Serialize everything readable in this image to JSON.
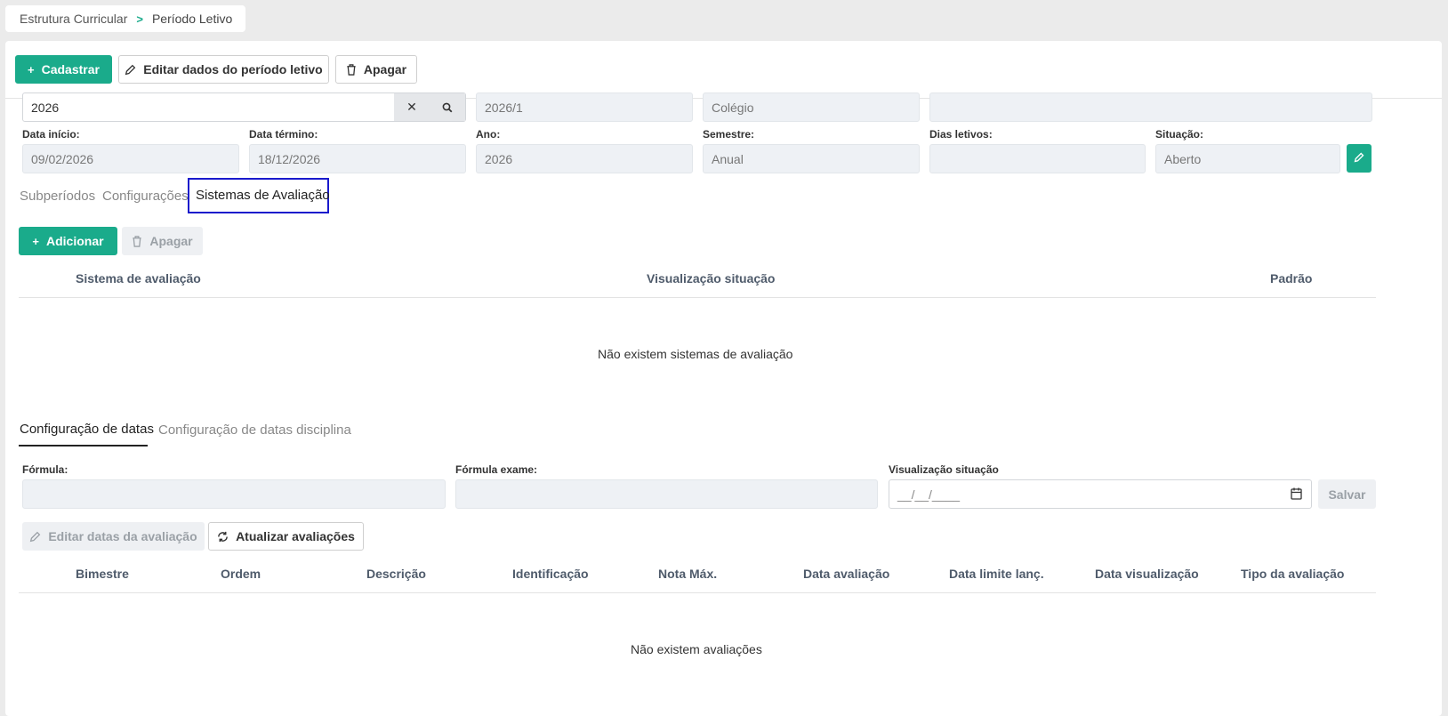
{
  "breadcrumb": {
    "parent": "Estrutura Curricular",
    "separator": ">",
    "current": "Período Letivo"
  },
  "toolbar": {
    "cadastrar": "Cadastrar",
    "editar": "Editar dados do período letivo",
    "apagar": "Apagar"
  },
  "form": {
    "search_value": "2026",
    "periodo": "2026/1",
    "instituicao": "Colégio",
    "descricao": "",
    "data_inicio_label": "Data início:",
    "data_inicio": "09/02/2026",
    "data_termino_label": "Data término:",
    "data_termino": "18/12/2026",
    "ano_label": "Ano:",
    "ano": "2026",
    "semestre_label": "Semestre:",
    "semestre": "Anual",
    "dias_letivos_label": "Dias letivos:",
    "dias_letivos": "",
    "situacao_label": "Situação:",
    "situacao": "Aberto"
  },
  "tabs": [
    {
      "label": "Subperíodos"
    },
    {
      "label": "Configurações"
    },
    {
      "label": "Sistemas de Avaliação"
    }
  ],
  "sistemas": {
    "adicionar": "Adicionar",
    "apagar": "Apagar",
    "columns": [
      "Sistema de avaliação",
      "Visualização situação",
      "Padrão"
    ],
    "empty": "Não existem sistemas de avaliação"
  },
  "subtabs": [
    {
      "label": "Configuração de datas"
    },
    {
      "label": "Configuração de datas disciplina"
    }
  ],
  "datas": {
    "formula_label": "Fórmula:",
    "formula": "",
    "formula_exame_label": "Fórmula exame:",
    "formula_exame": "",
    "visualizacao_label": "Visualização situação",
    "visualizacao_placeholder": "__/__/____",
    "salvar": "Salvar",
    "editar_datas": "Editar datas da avaliação",
    "atualizar": "Atualizar avaliações",
    "columns": [
      "Bimestre",
      "Ordem",
      "Descrição",
      "Identificação",
      "Nota Máx.",
      "Data avaliação",
      "Data limite lanç.",
      "Data visualização",
      "Tipo da avaliação"
    ],
    "empty": "Não existem avaliações"
  },
  "colors": {
    "accent": "#1aab8b",
    "highlight": "#1a1acc"
  }
}
